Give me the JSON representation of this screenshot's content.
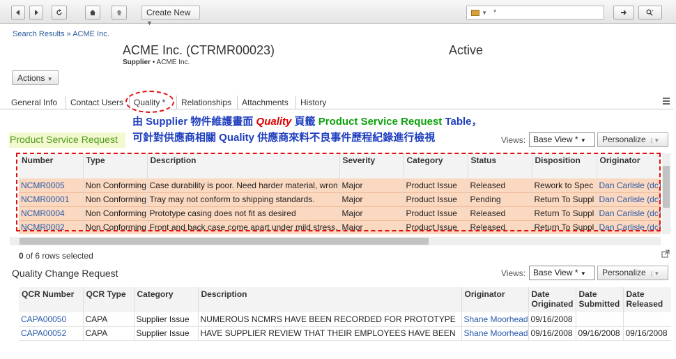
{
  "toolbar": {
    "create_new_label": "Create New",
    "search_value": "*"
  },
  "breadcrumb": "Search Results » ACME Inc.",
  "header": {
    "title": "ACME Inc. (CTRMR00023)",
    "subtitle_bold": "Supplier",
    "subtitle_rest": " • ACME Inc.",
    "status": "Active"
  },
  "actions_label": "Actions",
  "tabs": [
    {
      "label": "General Info"
    },
    {
      "label": "Contact Users"
    },
    {
      "label": "Quality *"
    },
    {
      "label": "Relationships"
    },
    {
      "label": "Attachments"
    },
    {
      "label": "History"
    }
  ],
  "annotation": {
    "line1_a": "由 ",
    "line1_b": "Supplier",
    "line1_c": " 物件維護畫面 ",
    "line1_d": "Quality",
    "line1_e": " 頁籤 ",
    "line1_f": "Product Service Request",
    "line1_g": " Table，",
    "line2_a": "可針對供應商相關 ",
    "line2_b": "Quality",
    "line2_c": " 供應商來料不良事件歷程紀錄進行檢視"
  },
  "psr": {
    "title": "Product Service Request",
    "views_label": "Views:",
    "view_value": "Base View *",
    "personalize_label": "Personalize",
    "columns": [
      "Number",
      "Type",
      "Description",
      "Severity",
      "Category",
      "Status",
      "Disposition",
      "Originator"
    ],
    "rows": [
      [
        "NCMR0005",
        "Non Conforming",
        "Case durability is poor. Need harder material, wron",
        "Major",
        "Product Issue",
        "Released",
        "Rework to Spec",
        "Dan Carlisle (dc)"
      ],
      [
        "NCMR00001",
        "Non Conforming",
        "Tray may not conform to shipping standards.",
        "Major",
        "Product Issue",
        "Pending",
        "Return To Suppl",
        "Dan Carlisle (dc)"
      ],
      [
        "NCMR0004",
        "Non Conforming",
        "Prototype casing does not fit as desired",
        "Major",
        "Product Issue",
        "Released",
        "Return To Suppl",
        "Dan Carlisle (dc)"
      ],
      [
        "NCMR0002",
        "Non Conforming",
        "Front and back case come apart under mild stress.",
        "Major",
        "Product Issue",
        "Released",
        "Return To Suppl",
        "Dan Carlisle (dc)"
      ]
    ],
    "rows_selected": "0",
    "rows_selected_rest": " of 6 rows selected"
  },
  "qcr": {
    "title": "Quality Change Request",
    "views_label": "Views:",
    "view_value": "Base View *",
    "personalize_label": "Personalize",
    "columns": [
      "QCR Number",
      "QCR Type",
      "Category",
      "Description",
      "Originator",
      "Date Originated",
      "Date Submitted",
      "Date Released"
    ],
    "rows": [
      [
        "CAPA00050",
        "CAPA",
        "Supplier Issue",
        "NUMEROUS NCMRS HAVE BEEN RECORDED FOR PROTOTYPE",
        "Shane Moorhead",
        "09/16/2008",
        "",
        ""
      ],
      [
        "CAPA00052",
        "CAPA",
        "Supplier Issue",
        "HAVE SUPPLIER REVIEW THAT THEIR EMPLOYEES HAVE BEEN",
        "Shane Moorhead",
        "09/16/2008",
        "09/16/2008",
        "09/16/2008"
      ]
    ]
  },
  "colors": {
    "annotation_blue": "#1f3fbf",
    "annotation_red": "#e00000",
    "annotation_green": "#0ca00c",
    "row_highlight": "#fbd8c0",
    "link": "#2a5aa8"
  }
}
